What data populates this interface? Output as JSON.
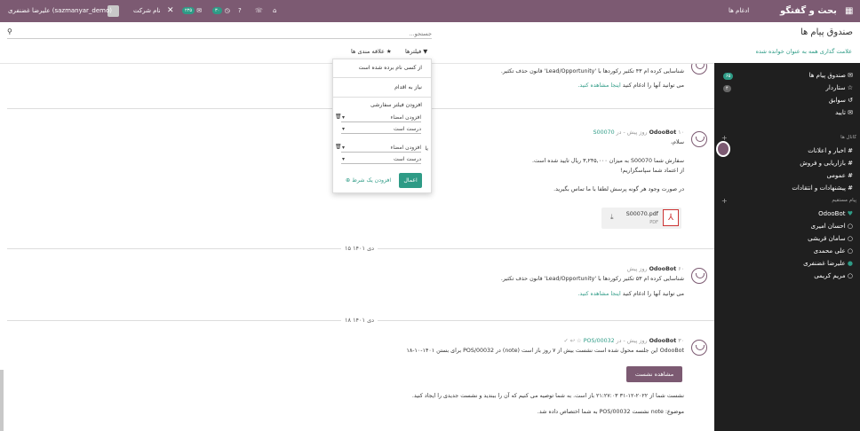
{
  "navbar": {
    "app_title": "بحث و گفتگو",
    "menu_integrations": "ادغام ها",
    "user_name": "علیرضا غضنفری (sazmanyar_demo)",
    "company": "نام شرکت",
    "activity_count": "۳۰",
    "message_count": "۲۳۵"
  },
  "control": {
    "breadcrumb": "صندوق پیام ها",
    "search_placeholder": "جستجو...",
    "mark_all_read": "علامت گذاری همه به عنوان خوانده شده",
    "filters_label": "فیلترها",
    "favorites_label": "علاقه مندی ها"
  },
  "dropdown": {
    "opt1": "از کسی نام برده شده است",
    "opt2": "نیاز به اقدام",
    "add_custom": "افزودن فیلتر سفارشی",
    "field1": "افزودن امضاء",
    "op1": "درست است",
    "or_label": "یا",
    "field2": "افزودن امضاء",
    "op2": "درست است",
    "apply": "اعمال",
    "add_condition": "افزودن یک شرط"
  },
  "sidebar": {
    "inbox": "صندوق پیام ها",
    "inbox_count": "۶۵",
    "starred": "ستاردار",
    "starred_count": "۴",
    "history": "سوابق",
    "approve": "تایید",
    "channels_title": "کانال ها",
    "channels": [
      "اخبار و اعلانات",
      "بازاریابی و فروش",
      "عمومی",
      "پیشنهادات و انتقادات"
    ],
    "dm_title": "پیام مستقیم",
    "dms": [
      "OdooBot",
      "احسان امیری",
      "سامان قریشی",
      "علی محمدی",
      "علیرضا غضنفری",
      "مریم کریمی"
    ]
  },
  "messages": {
    "m0_line1": "شناسایی کرده ام ۴۳ تکثیر رکوردها با 'Lead/Opportunity' قانون حذف تکثیر.",
    "m0_line2": "می توانید آنها را ادغام کنید",
    "m0_link": "اینجا مشاهده کنید.",
    "m1_author": "OdooBot",
    "m1_time": "۱۰ روز پیش - در",
    "m1_ref": "S00070",
    "m1_hello": "سلام،",
    "m1_l1": "سفارش شما S00070 به میزان ۳,۲۴۵,۰۰۰ ریال تایید شده است.",
    "m1_l2": "از اعتماد شما سپاسگزاریم!",
    "m1_l3": "در صورت وجود هر گونه پرسش لطفا با ما تماس بگیرید.",
    "m1_file": "S00070.pdf",
    "m1_file_type": "PDF",
    "date1": "۱۵ دی ۱۴۰۱",
    "m2_author": "OdooBot",
    "m2_time": "۶۰ روز پیش",
    "m2_l1": "شناسایی کرده ام ۵۳ تکثیر رکوردها با 'Lead/Opportunity' قانون حذف تکثیر.",
    "m2_l2": "می توانید آنها را ادغام کنید",
    "m2_link": "اینجا مشاهده کنید.",
    "date2": "۱۸ دی ۱۴۰۱",
    "m3_author": "OdooBot",
    "m3_time": "۳۰ روز پیش - در",
    "m3_ref": "POS/00032",
    "m3_l1": "OdooBot این جلسه محول شده است نشست بیش از ۷ روز باز است (note) در POS/00032 برای بستن ۱۴۰۱-۱۰-۱۸",
    "m3_btn": "مشاهده نشست",
    "m3_l2": "نشست شما از ۲۰۲۲-۱۲-۳۱ ۲۱:۲۷:۰۳ باز است. به شما توصیه می کنیم که آن را ببندید و نشست جدیدی را ایجاد کنید.",
    "m3_l3": "موضوع: note نشست POS/00032 به شما اختصاص داده شد."
  }
}
